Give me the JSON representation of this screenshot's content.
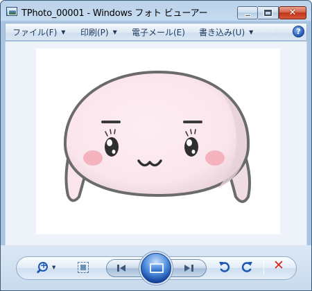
{
  "window": {
    "title": "TPhoto_00001 - Windows フォト ビューアー",
    "minimize_icon": "minimize-icon",
    "maximize_icon": "maximize-icon",
    "close_glyph": "✕"
  },
  "menu": {
    "items": [
      {
        "label": "ファイル(F)",
        "has_dropdown": true
      },
      {
        "label": "印刷(P)",
        "has_dropdown": true
      },
      {
        "label": "電子メール(E)",
        "has_dropdown": false
      },
      {
        "label": "書き込み(U)",
        "has_dropdown": true
      }
    ],
    "overflow_glyph": "»",
    "help_glyph": "?"
  },
  "photo": {
    "subject": "pink round blob character with face",
    "colors": {
      "body": "#fbe5ec",
      "outline": "#6b6b6b",
      "cheek": "#f5b3bd",
      "shade": "#e9d2d8"
    }
  },
  "controls": {
    "zoom_icon": "zoom-in-icon",
    "fit_icon": "actual-size-icon",
    "prev_icon": "previous-icon",
    "slideshow_icon": "slideshow-icon",
    "next_icon": "next-icon",
    "rotate_left_icon": "rotate-counterclockwise-icon",
    "rotate_right_icon": "rotate-clockwise-icon",
    "delete_glyph": "✕"
  }
}
